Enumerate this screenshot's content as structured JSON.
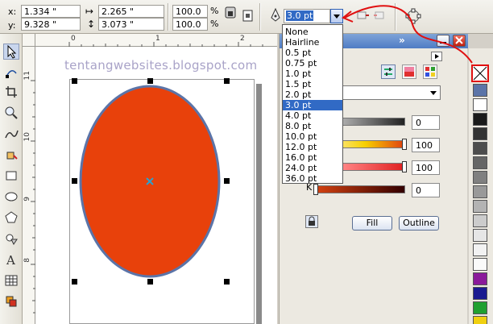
{
  "propbar": {
    "x_label": "x:",
    "x_value": "1.334 \"",
    "y_label": "y:",
    "y_value": "9.328 \"",
    "width_value": "2.265 \"",
    "height_value": "3.073 \"",
    "scale_x": "100.0",
    "scale_y": "100.0",
    "pct_sign_1": "%",
    "pct_sign_2": "%",
    "outline_width": "3.0 pt"
  },
  "ruler_top": {
    "label_0": "0",
    "label_1": "1",
    "label_2": "2"
  },
  "ruler_left": {
    "label_11": "11",
    "label_10": "10",
    "label_9": "9",
    "label_8": "8"
  },
  "watermark": "tentangwebsites.blogspot.com",
  "outline_dropdown": {
    "options": [
      "None",
      "Hairline",
      "0.5 pt",
      "0.75 pt",
      "1.0 pt",
      "1.5 pt",
      "2.0 pt",
      "3.0 pt",
      "4.0 pt",
      "8.0 pt",
      "10.0 pt",
      "12.0 pt",
      "16.0 pt",
      "24.0 pt",
      "36.0 pt"
    ],
    "selected": "3.0 pt"
  },
  "docker": {
    "slider_values": [
      "0",
      "100",
      "100",
      "0"
    ],
    "k_label": "K",
    "fill_button": "Fill",
    "outline_button": "Outline"
  },
  "colors": {
    "ellipse_fill": "#e8410b",
    "ellipse_outline": "#5b74a8",
    "highlight_selection": "#316ac5",
    "annotation_red": "#e01010",
    "center_marker": "#2aa0d0"
  }
}
